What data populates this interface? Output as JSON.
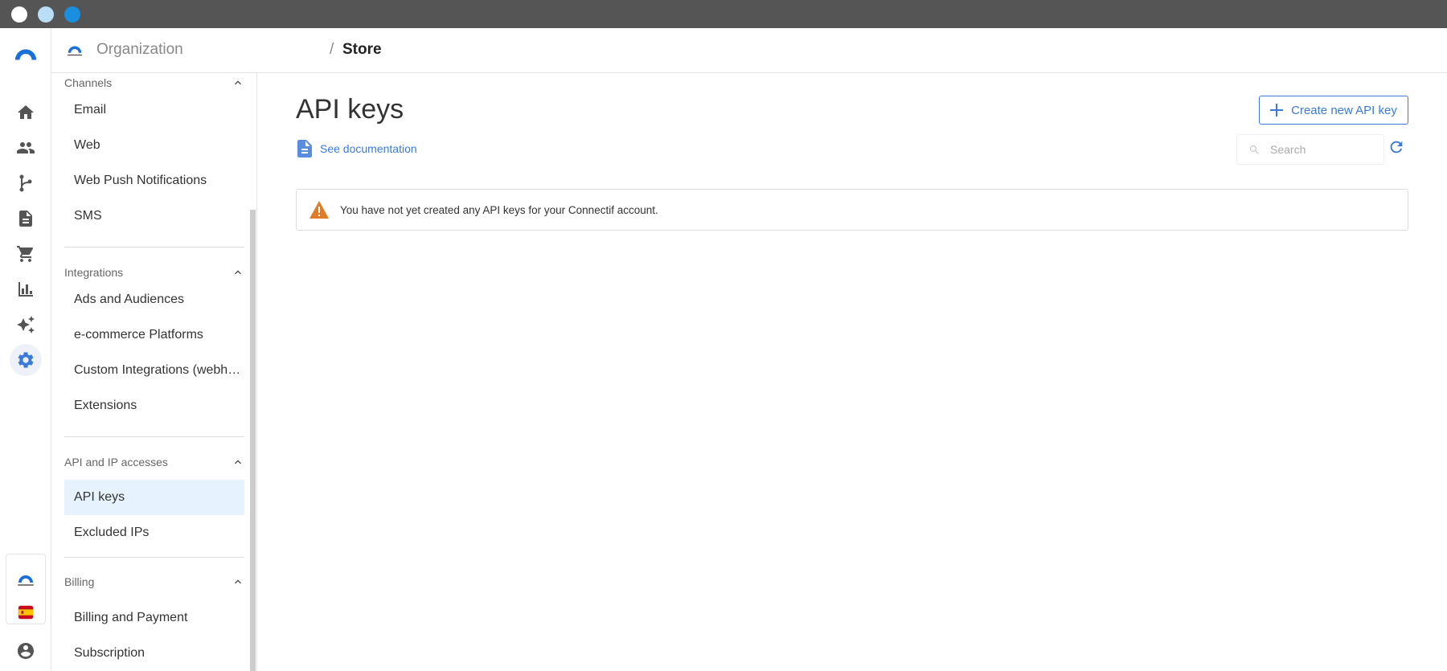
{
  "window": {
    "dots": [
      "#ffffff",
      "#b9def7",
      "#1a8fe0"
    ]
  },
  "rail": {
    "items": [
      {
        "name": "logo-icon"
      },
      {
        "name": "home-icon"
      },
      {
        "name": "contacts-icon"
      },
      {
        "name": "workflows-icon"
      },
      {
        "name": "content-icon"
      },
      {
        "name": "store-icon"
      },
      {
        "name": "reports-icon"
      },
      {
        "name": "ai-icon"
      },
      {
        "name": "settings-icon",
        "active": true
      }
    ],
    "bottom": [
      "connectif-account-icon",
      "spain-flag-icon",
      "user-profile-icon"
    ]
  },
  "topbar": {
    "org_name": "Organization",
    "separator": "/",
    "store": "Store"
  },
  "sidebar": {
    "sections": [
      {
        "title": "Channels",
        "items": [
          "Email",
          "Web",
          "Web Push Notifications",
          "SMS"
        ]
      },
      {
        "title": "Integrations",
        "items": [
          "Ads and Audiences",
          "e-commerce Platforms",
          "Custom Integrations (webhooks)",
          "Extensions"
        ]
      },
      {
        "title": "API and IP accesses",
        "items": [
          "API keys",
          "Excluded IPs"
        ]
      },
      {
        "title": "Billing",
        "items": [
          "Billing and Payment",
          "Subscription"
        ]
      }
    ],
    "active_item": "API keys"
  },
  "main": {
    "title": "API keys",
    "doc_link": "See documentation",
    "create_button": "Create new API key",
    "search_placeholder": "Search",
    "notice": "You have not yet created any API keys for your Connectif account."
  },
  "colors": {
    "accent": "#3b7ad9",
    "active_bg": "#e6f2fd",
    "warning": "#e07b28"
  }
}
